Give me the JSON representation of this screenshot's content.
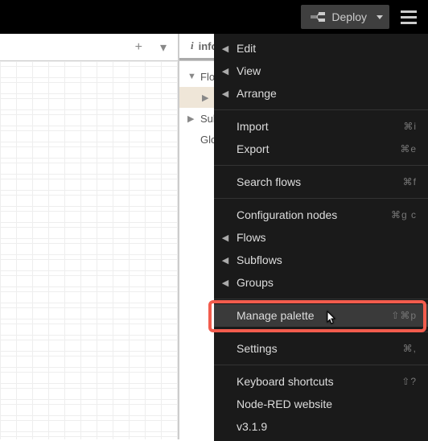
{
  "topbar": {
    "deploy_label": "Deploy"
  },
  "sidebar": {
    "tab_label": "info",
    "tree": {
      "flows_label": "Flows",
      "subflows_label": "Subflows",
      "globals_label": "Global Configuration Nodes"
    }
  },
  "menu": {
    "edit": "Edit",
    "view": "View",
    "arrange": "Arrange",
    "import": "Import",
    "import_shortcut": "⌘i",
    "export": "Export",
    "export_shortcut": "⌘e",
    "search_flows": "Search flows",
    "search_flows_shortcut": "⌘f",
    "config_nodes": "Configuration nodes",
    "config_nodes_shortcut": "⌘g c",
    "flows": "Flows",
    "subflows": "Subflows",
    "groups": "Groups",
    "manage_palette": "Manage palette",
    "manage_palette_shortcut": "⇧⌘p",
    "settings": "Settings",
    "settings_shortcut": "⌘,",
    "keyboard_shortcuts": "Keyboard shortcuts",
    "keyboard_shortcuts_shortcut": "⇧?",
    "website": "Node-RED website",
    "version": "v3.1.9"
  }
}
